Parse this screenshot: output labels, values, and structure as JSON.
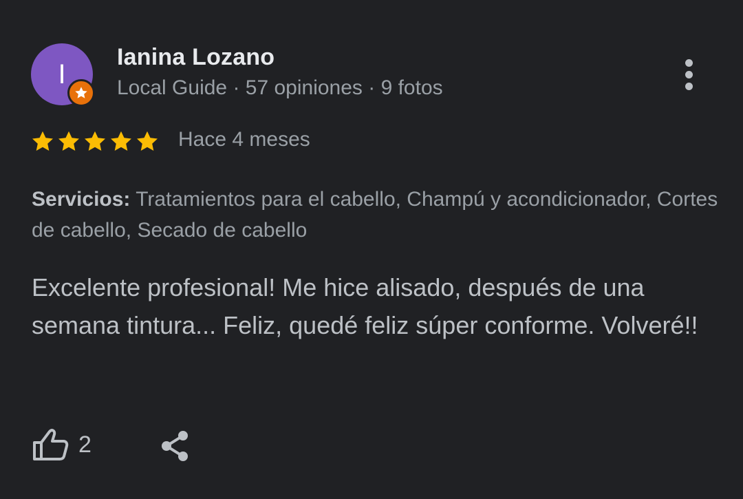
{
  "review": {
    "author": {
      "avatar_initial": "I",
      "name": "Ianina Lozano",
      "meta": "Local Guide · 57 opiniones · 9 fotos",
      "avatar_color": "#7e57c2",
      "badge_color": "#e8710a",
      "badge_icon": "star-icon"
    },
    "rating": {
      "stars": 5,
      "max_stars": 5,
      "star_color": "#fbbc04"
    },
    "date": "Hace 4 meses",
    "services": {
      "label": "Servicios:",
      "value": " Tratamientos para el cabello, Champú y acondicionador, Cortes de cabello, Secado de cabello"
    },
    "text": "Excelente profesional! Me hice alisado, después de una semana tintura... Feliz, quedé feliz súper conforme. Volveré!!",
    "actions": {
      "like_count": "2",
      "like_icon": "thumbs-up-icon",
      "share_icon": "share-icon",
      "more_icon": "more-vert-icon"
    }
  }
}
